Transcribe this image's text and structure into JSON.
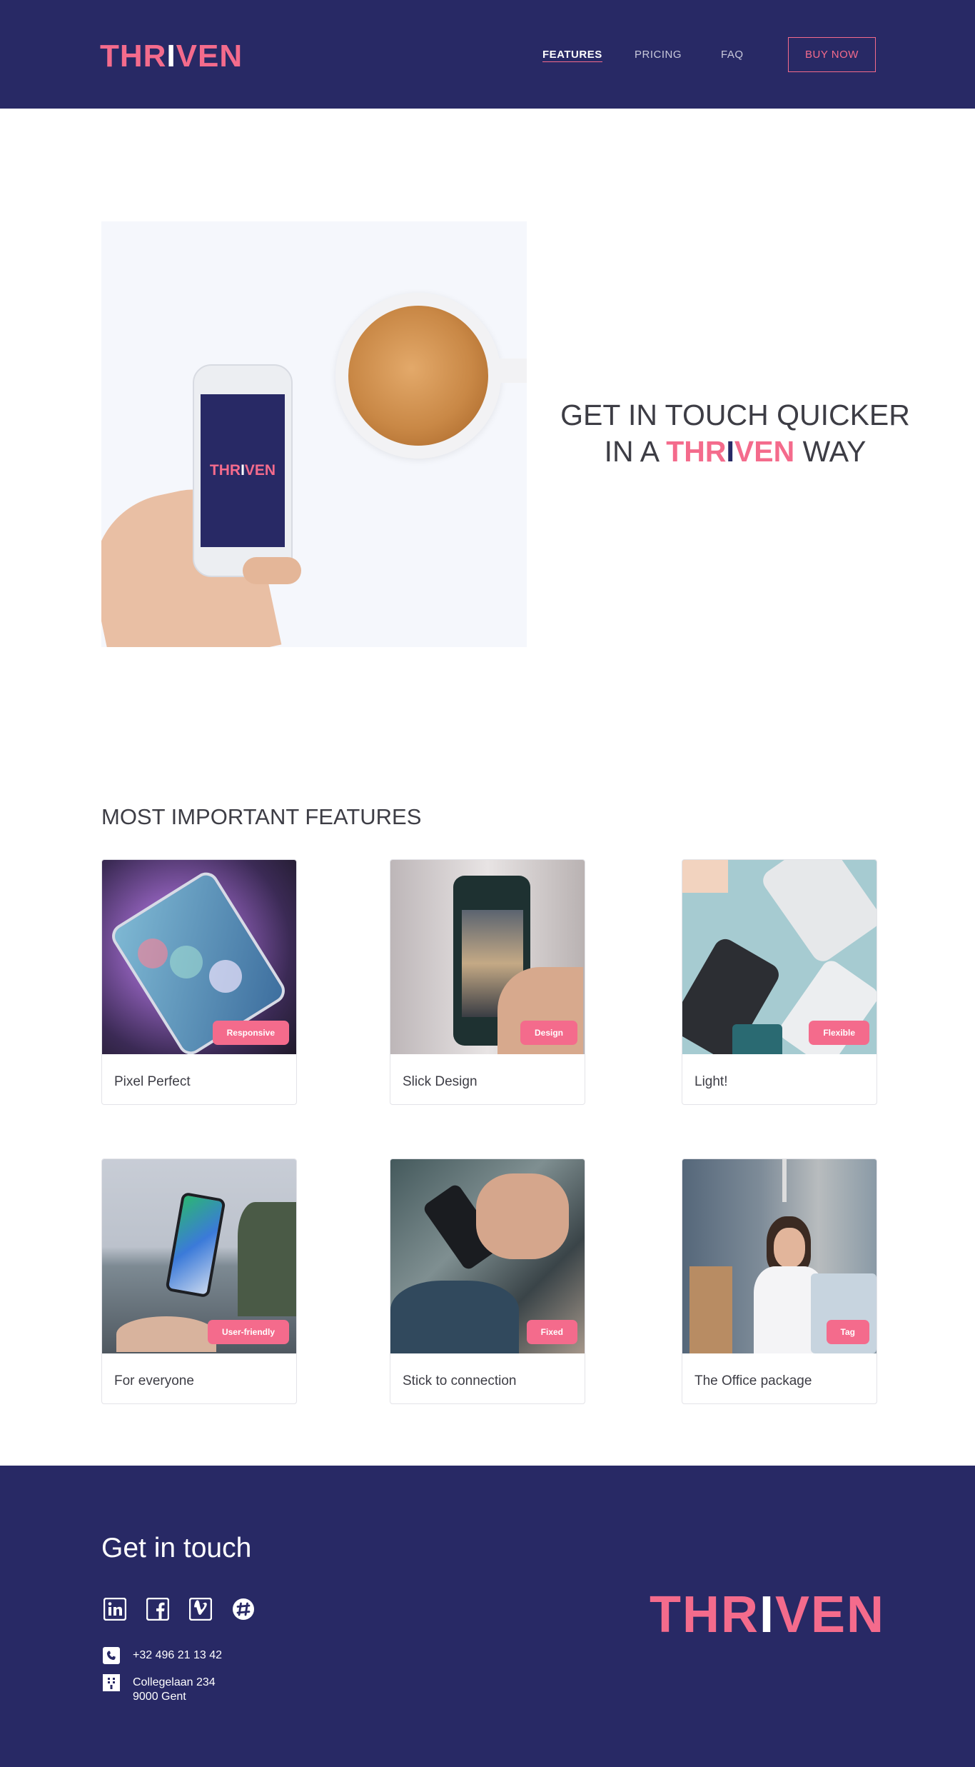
{
  "header": {
    "logo_part1": "THR",
    "logo_part2": "I",
    "logo_part3": "VEN",
    "nav": [
      "FEATURES",
      "PRICING",
      "FAQ"
    ],
    "buy_label": "BUY NOW"
  },
  "hero": {
    "phone_logo_part1": "THR",
    "phone_logo_part2": "I",
    "phone_logo_part3": "VEN",
    "title_line1": "GET IN TOUCH QUICKER",
    "title_prefix": "IN A",
    "brand_part1": "THR",
    "brand_part2": "I",
    "brand_part3": "VEN",
    "title_suffix": "WAY"
  },
  "features": {
    "title": "MOST IMPORTANT FEATURES",
    "cards": [
      {
        "title": "Pixel Perfect",
        "tag": "Responsive"
      },
      {
        "title": "Slick Design",
        "tag": "Design"
      },
      {
        "title": "Light!",
        "tag": "Flexible"
      },
      {
        "title": "For everyone",
        "tag": "User-friendly"
      },
      {
        "title": "Stick to connection",
        "tag": "Fixed"
      },
      {
        "title": "The Office package",
        "tag": "Tag"
      }
    ]
  },
  "footer": {
    "title": "Get in touch",
    "social": [
      "linkedin-icon",
      "facebook-icon",
      "vimeo-icon",
      "slack-icon"
    ],
    "phone": "+32 496 21 13 42",
    "address_line1": "Collegelaan 234",
    "address_line2": "9000 Gent",
    "logo_part1": "THR",
    "logo_part2": "I",
    "logo_part3": "VEN"
  },
  "colors": {
    "navy": "#282965",
    "pink": "#f46b8c"
  }
}
